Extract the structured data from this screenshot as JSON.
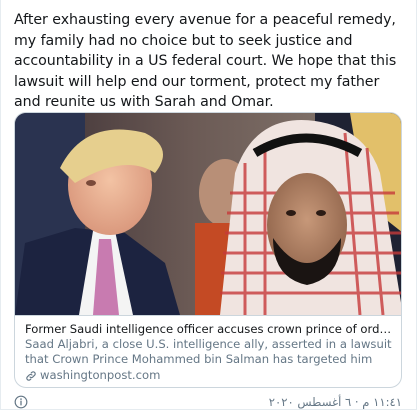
{
  "tweet": {
    "text": "After exhausting every avenue for a peaceful remedy, my family had no choice but to seek justice and accountability in a US federal court. We hope that this lawsuit will help end our torment, protect my father and reunite us with Sarah and Omar.",
    "timestamp": "١١:٤١ م · ٦ أغسطس ٢٠٢٠"
  },
  "card": {
    "title": "Former Saudi intelligence officer accuses crown prince of ordering his ass...",
    "description": "Saad Aljabri, a close U.S. intelligence ally, asserted in a lawsuit that Crown Prince Mohammed bin Salman has targeted him and his family for his ...",
    "domain": "washingtonpost.com"
  },
  "icons": {
    "link": "link-icon",
    "info": "info-circle-icon"
  },
  "colors": {
    "text": "#14171a",
    "secondary": "#657786",
    "border": "#ccd6dd"
  }
}
